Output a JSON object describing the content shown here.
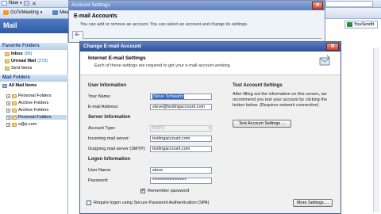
{
  "outlook": {
    "toolbar": {
      "new_label": "New",
      "gotomeeting_label": "GoToMeeting",
      "meeting_label": "Meet"
    },
    "pane_title": "Mail",
    "favorites_header": "Favorite Folders",
    "favorites": [
      {
        "name": "Inbox",
        "count": "(56)"
      },
      {
        "name": "Unread Mail",
        "count": "(273)"
      },
      {
        "name": "Sent Items",
        "count": ""
      }
    ],
    "mail_folders_header": "Mail Folders",
    "all_mail_items": "All Mail Items",
    "folders": [
      "Personal Folders",
      "Archive Folders",
      "Archive Folders",
      "Personal Folders",
      "s@p.com"
    ],
    "yousendit_label": "YouSendIt"
  },
  "account_settings": {
    "title": "Account Settings",
    "heading": "E-mail Accounts",
    "subtitle": "You can add or remove an account. You can select an account and change its settings.",
    "tabs": [
      "E-"
    ]
  },
  "dialog": {
    "title": "Change E-mail Account",
    "header_title": "Internet E-mail Settings",
    "header_sub": "Each of these settings are required to get your e-mail account working.",
    "user_info": {
      "section": "User Information",
      "your_name_label": "Your Name:",
      "your_name_value": "Steve Schwartz",
      "email_label": "E-mail Address:",
      "email_value": "steve@testingaccount.com"
    },
    "server_info": {
      "section": "Server Information",
      "account_type_label": "Account Type:",
      "account_type_value": "POP3",
      "incoming_label": "Incoming mail server:",
      "incoming_value": "testingaccount.com",
      "outgoing_label": "Outgoing mail server (SMTP):",
      "outgoing_value": "testingaccount.com"
    },
    "logon_info": {
      "section": "Logon Information",
      "username_label": "User Name:",
      "username_value": "steve",
      "password_label": "Password:",
      "password_value": "********************",
      "remember_label": "Remember password",
      "remember_checked": "✔",
      "spa_label": "Require logon using Secure Password Authentication (SPA)"
    },
    "test": {
      "section": "Test Account Settings",
      "description": "After filling out the information on this screen, we recommend you test your account by clicking the button below. (Requires network connection)",
      "button_label": "Test Account Settings ..."
    },
    "more_settings_label": "More Settings ..."
  }
}
